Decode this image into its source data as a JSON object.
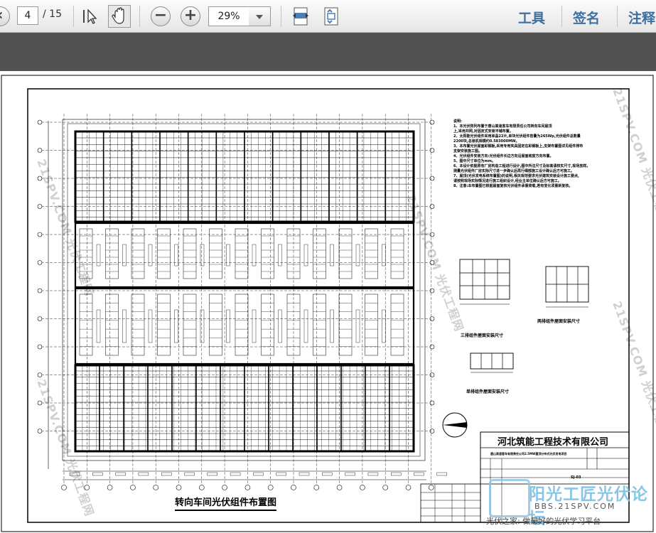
{
  "toolbar": {
    "current_page": "4",
    "total_pages": "/ 15",
    "zoom": "29%",
    "menu_tools": "工具",
    "menu_sign": "签名",
    "menu_comment": "注释"
  },
  "drawing": {
    "title": "转向车间光伏组件布置图",
    "company": "河北筑能工程技术有限公司",
    "notes_title": "说明:",
    "notes": [
      "1、本光伏阵列布置于唐山高速客车有限责任公司转向车间屋顶",
      "   上,采用并网,对固定式安装平铺布置。",
      "2、太阳能光伏组件采用单晶22片,单块光伏组件容量为265Wp,光伏组件总数量",
      "   2200块,总装机规模约0.583000MW。",
      "3、本布置光伏屋面彩钢板,采用专用夹具固定在彩钢板上,支架布置图详见组件排布",
      "   支架安装施工图。",
      "4、光伏组件安装方向:光伏组件长边方向沿屋面坡度方向布置。",
      "5、图中尺寸单位为mm。",
      "6、本设计依据原有厂房构造工程进行设计,图中所注尺寸及标高请核实尺寸,现场放样。",
      "   测量光伏组件厂房实际尺寸进一步确认后再行细部施工设计确认后方可施工。",
      "7、屋顶(光伏发电系统布置图)的说明,相关规范要求光伏建筑安装设计施工要点,",
      "   请按照现场实际情况进行施工组织设计,经业主单位确认后方可施工。",
      "8、注意:本布置图已根据屋面复核光伏组件承重荷载,若有变化须重新复核。"
    ],
    "detail_label_1": "三排组件屋面安装尺寸",
    "detail_label_2": "两排组件屋面安装尺寸",
    "detail_label_3": "单排组件屋面安装尺寸",
    "project_name": "唐山高速客车有限责任公司2.5MW屋顶分布式光伏发电项目",
    "drawing_no": "SJ-03",
    "watermark_text": "21SPV.COM 光伏工程网",
    "forum_logo": "阳光工匠光伏论坛",
    "forum_url": "BBS.21SPV.COM",
    "forum_slogan": "光伏之家: 做最好的光伏学习平台"
  }
}
